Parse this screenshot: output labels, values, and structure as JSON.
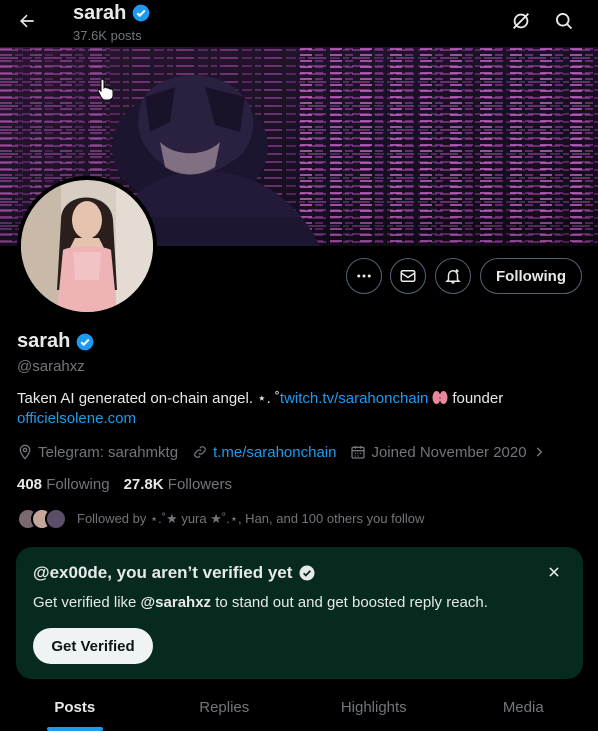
{
  "header": {
    "title": "sarah",
    "posts_count": "37.6K posts"
  },
  "profile": {
    "name": "sarah",
    "handle": "@sarahxz",
    "bio": {
      "text1": "Taken AI generated on-chain angel. ⋆.  ˚",
      "link1": "twitch.tv/sarahonchain",
      "text2": "founder",
      "link2": "officielsolene.com"
    },
    "telegram": "Telegram: sarahmktg",
    "website": "t.me/sarahonchain",
    "joined": "Joined November 2020",
    "following_count": "408",
    "following_label": "Following",
    "followers_count": "27.8K",
    "followers_label": "Followers",
    "followed_by": "Followed by ⋆.˚★ yura ★˚.⋆, Han, and 100 others you follow"
  },
  "actions": {
    "following_label": "Following"
  },
  "verify_card": {
    "title": "@ex00de, you aren’t verified yet",
    "text_prefix": "Get verified like",
    "text_handle": "@sarahxz",
    "text_suffix": "to stand out and get boosted reply reach.",
    "button_label": "Get Verified"
  },
  "tabs": [
    {
      "label": "Posts",
      "active": true
    },
    {
      "label": "Replies",
      "active": false
    },
    {
      "label": "Highlights",
      "active": false
    },
    {
      "label": "Media",
      "active": false
    }
  ],
  "colors": {
    "accent": "#1d9bf0",
    "verified": "#1d9bf0",
    "muted": "#71767b",
    "card_bg": "#072a1f"
  }
}
